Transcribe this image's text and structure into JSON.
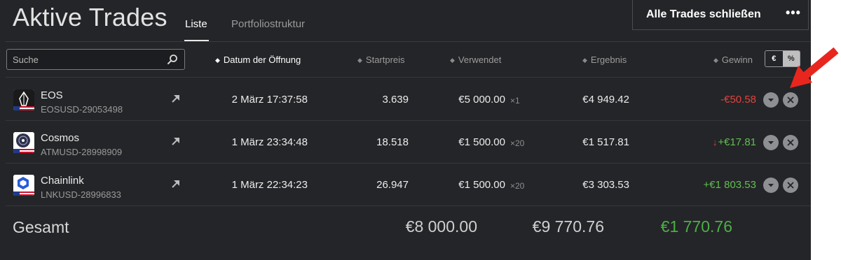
{
  "header": {
    "title": "Aktive Trades",
    "tabs": [
      "Liste",
      "Portfoliostruktur"
    ],
    "close_all_label": "Alle Trades schließen",
    "more_label": "•••"
  },
  "search": {
    "placeholder": "Suche"
  },
  "columns": {
    "date": "Datum der Öffnung",
    "start": "Startpreis",
    "used": "Verwendet",
    "result": "Ergebnis",
    "gain": "Gewinn",
    "sort_glyph": "◆"
  },
  "currency_toggle": {
    "eur": "€",
    "pct": "%"
  },
  "trades": [
    {
      "name": "EOS",
      "ticker": "EOSUSD-29053498",
      "date": "2 März 17:37:58",
      "start": "3.639",
      "used": "€5 000.00",
      "leverage": "×1",
      "result": "€4 949.42",
      "gain": "-€50.58",
      "gain_color": "#e0433f"
    },
    {
      "name": "Cosmos",
      "ticker": "ATMUSD-28998909",
      "date": "1 März 23:34:48",
      "start": "18.518",
      "used": "€1 500.00",
      "leverage": "×20",
      "result": "€1 517.81",
      "gain": "+€17.81",
      "gain_color": "#5fbf4e",
      "down_marker": "↓"
    },
    {
      "name": "Chainlink",
      "ticker": "LNKUSD-28996833",
      "date": "1 März 22:34:23",
      "start": "26.947",
      "used": "€1 500.00",
      "leverage": "×20",
      "result": "€3 303.53",
      "gain": "+€1 803.53",
      "gain_color": "#5fbf4e"
    }
  ],
  "totals": {
    "label": "Gesamt",
    "used": "€8 000.00",
    "result": "€9 770.76",
    "gain": "€1 770.76"
  },
  "annotation_color": "#e8261e"
}
